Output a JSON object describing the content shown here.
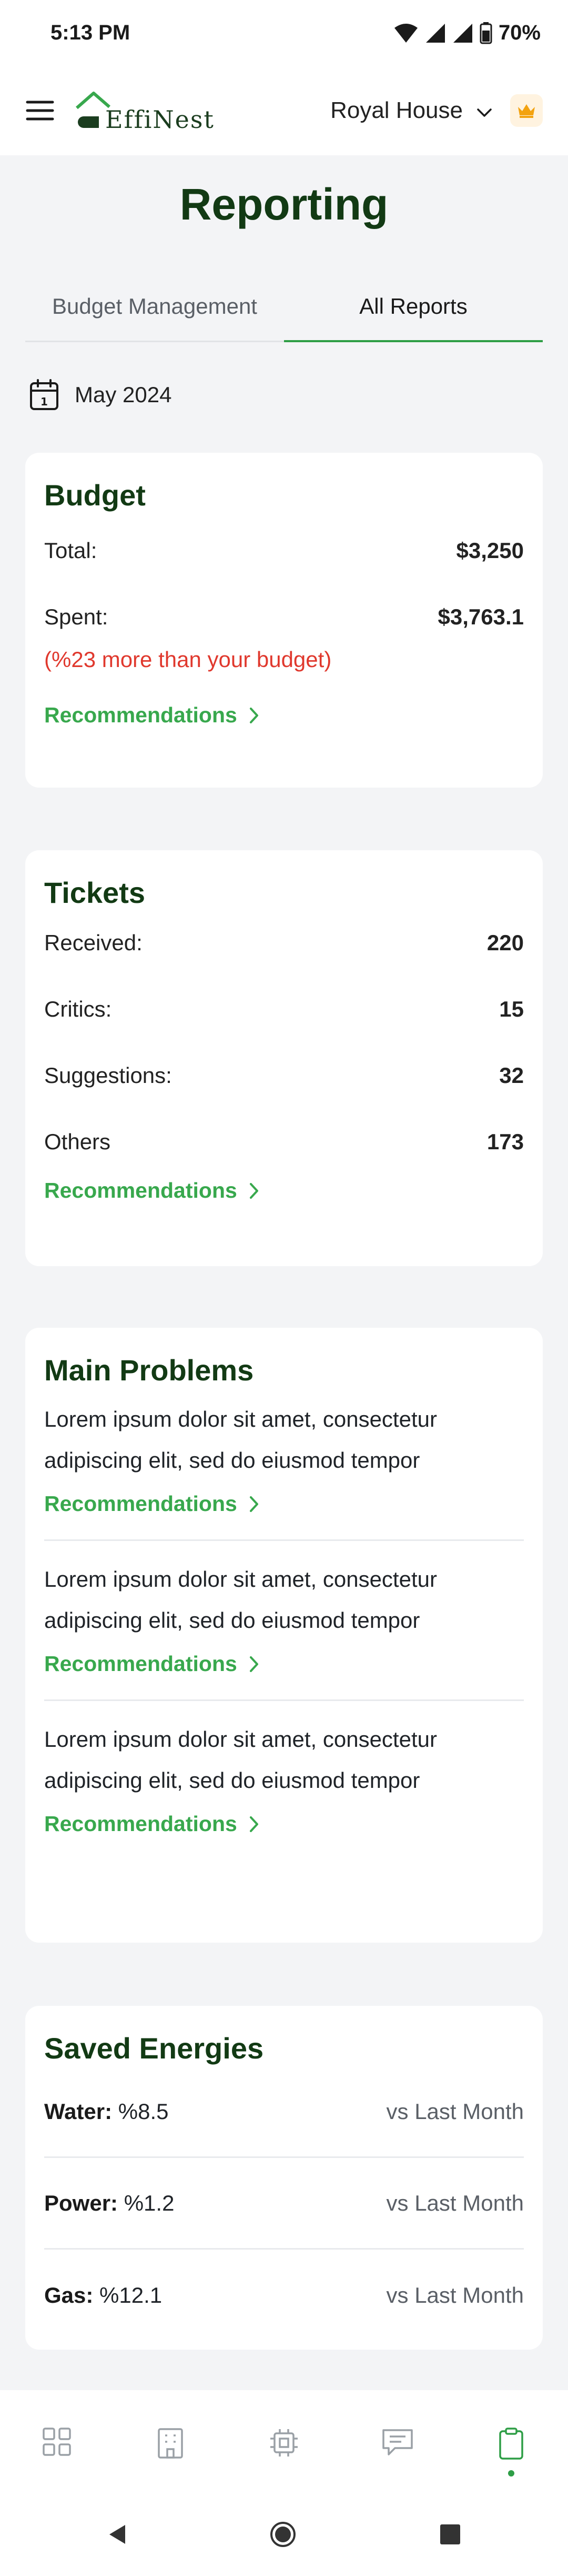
{
  "status": {
    "time": "5:13 PM",
    "battery": "70%"
  },
  "header": {
    "brand": "EffiNest",
    "org": "Royal House"
  },
  "page": {
    "title": "Reporting"
  },
  "tabs": [
    {
      "label": "Budget Management",
      "active": false
    },
    {
      "label": "All Reports",
      "active": true
    }
  ],
  "period": {
    "label": "May 2024"
  },
  "budget": {
    "title": "Budget",
    "rows": [
      {
        "label": "Total:",
        "value": "$3,250"
      },
      {
        "label": "Spent:",
        "value": "$3,763.1"
      }
    ],
    "warning": "(%23 more than your budget)",
    "recommendations": "Recommendations"
  },
  "tickets": {
    "title": "Tickets",
    "rows": [
      {
        "label": "Received:",
        "value": "220"
      },
      {
        "label": "Critics:",
        "value": "15"
      },
      {
        "label": "Suggestions:",
        "value": "32"
      },
      {
        "label": "Others",
        "value": "173"
      }
    ],
    "recommendations": "Recommendations"
  },
  "problems": {
    "title": "Main Problems",
    "items": [
      {
        "text": "Lorem ipsum dolor sit amet, consectetur adipiscing elit, sed do eiusmod tempor",
        "link": "Recommendations"
      },
      {
        "text": "Lorem ipsum dolor sit amet, consectetur adipiscing elit, sed do eiusmod tempor",
        "link": "Recommendations"
      },
      {
        "text": "Lorem ipsum dolor sit amet, consectetur adipiscing elit, sed do eiusmod tempor",
        "link": "Recommendations"
      }
    ]
  },
  "energies": {
    "title": "Saved Energies",
    "items": [
      {
        "label": "Water:",
        "value": "%8.5",
        "compare": "vs Last Month"
      },
      {
        "label": "Power:",
        "value": "%1.2",
        "compare": "vs Last Month"
      },
      {
        "label": "Gas:",
        "value": "%12.1",
        "compare": "vs Last Month"
      }
    ]
  },
  "bottom_nav": [
    {
      "icon": "dashboard-grid-icon",
      "active": false
    },
    {
      "icon": "building-icon",
      "active": false
    },
    {
      "icon": "chip-icon",
      "active": false
    },
    {
      "icon": "message-icon",
      "active": false
    },
    {
      "icon": "clipboard-icon",
      "active": true
    }
  ],
  "colors": {
    "brand_green": "#123a14",
    "accent_green": "#38a84d",
    "warning_red": "#e0382d",
    "background": "#f3f4f6"
  }
}
